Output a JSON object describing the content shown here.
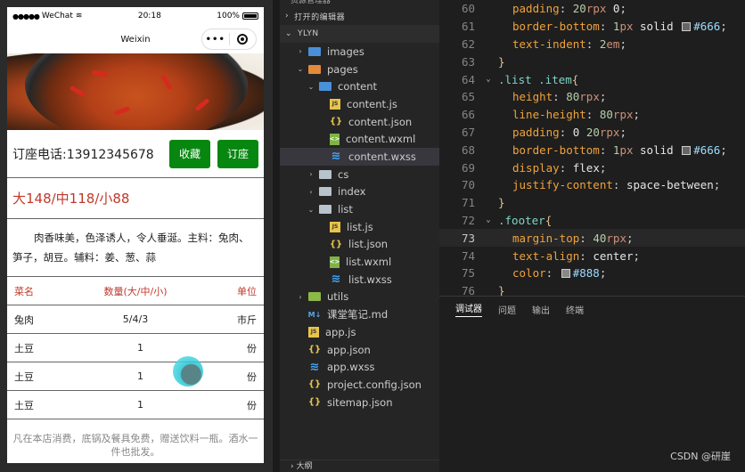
{
  "phone": {
    "status": {
      "carrier": "WeChat",
      "time": "20:18",
      "battery": "100%"
    },
    "nav_title": "Weixin",
    "capsule_more": "•••",
    "order_phone": "订座电话:13912345678",
    "buttons": {
      "favorite": "收藏",
      "reserve": "订座"
    },
    "price": "大148/中118/小88",
    "description": "肉香味美，色泽诱人，令人垂涎。主料：兔肉、笋子，胡豆。辅料：姜、葱、蒜",
    "table": {
      "headers": [
        "菜名",
        "数量(大/中/小)",
        "单位"
      ],
      "rows": [
        [
          "兔肉",
          "5/4/3",
          "市斤"
        ],
        [
          "土豆",
          "1",
          "份"
        ],
        [
          "土豆",
          "1",
          "份"
        ],
        [
          "土豆",
          "1",
          "份"
        ]
      ]
    },
    "footer": "凡在本店消费，底锅及餐具免费，赠送饮料一瓶。酒水一件也批发。"
  },
  "explorer": {
    "top_label": "资源管理器",
    "open_editors": "打开的编辑器",
    "project": "YLYN",
    "tree": [
      {
        "label": "images",
        "type": "folder",
        "color": "blue",
        "depth": 1,
        "chevron": "›"
      },
      {
        "label": "pages",
        "type": "folder",
        "color": "orange",
        "depth": 1,
        "chevron": "⌄"
      },
      {
        "label": "content",
        "type": "folder",
        "color": "blue",
        "depth": 2,
        "chevron": "⌄"
      },
      {
        "label": "content.js",
        "type": "js",
        "depth": 3
      },
      {
        "label": "content.json",
        "type": "json",
        "depth": 3
      },
      {
        "label": "content.wxml",
        "type": "wxml",
        "depth": 3
      },
      {
        "label": "content.wxss",
        "type": "wxss",
        "depth": 3,
        "selected": true
      },
      {
        "label": "cs",
        "type": "folder",
        "color": "gray",
        "depth": 2,
        "chevron": "›"
      },
      {
        "label": "index",
        "type": "folder",
        "color": "gray",
        "depth": 2,
        "chevron": "›"
      },
      {
        "label": "list",
        "type": "folder",
        "color": "gray",
        "depth": 2,
        "chevron": "⌄"
      },
      {
        "label": "list.js",
        "type": "js",
        "depth": 3
      },
      {
        "label": "list.json",
        "type": "json",
        "depth": 3
      },
      {
        "label": "list.wxml",
        "type": "wxml",
        "depth": 3
      },
      {
        "label": "list.wxss",
        "type": "wxss",
        "depth": 3
      },
      {
        "label": "utils",
        "type": "folder",
        "color": "green",
        "depth": 1,
        "chevron": "›"
      },
      {
        "label": "课堂笔记.md",
        "type": "md",
        "depth": 1
      },
      {
        "label": "app.js",
        "type": "js",
        "depth": 1
      },
      {
        "label": "app.json",
        "type": "json",
        "depth": 1
      },
      {
        "label": "app.wxss",
        "type": "wxss",
        "depth": 1
      },
      {
        "label": "project.config.json",
        "type": "json",
        "depth": 1
      },
      {
        "label": "sitemap.json",
        "type": "json",
        "depth": 1
      }
    ],
    "outline": "大纲"
  },
  "editor": {
    "current_line": 73,
    "lines": [
      {
        "n": 60,
        "indent": 1,
        "parts": [
          [
            "prop",
            "padding"
          ],
          [
            "punc",
            ": "
          ],
          [
            "num",
            "20"
          ],
          [
            "unit",
            "rpx"
          ],
          [
            "val",
            " 0"
          ],
          [
            "punc",
            ";"
          ]
        ]
      },
      {
        "n": 61,
        "indent": 1,
        "parts": [
          [
            "prop",
            "border-bottom"
          ],
          [
            "punc",
            ": "
          ],
          [
            "num",
            "1"
          ],
          [
            "unit",
            "px"
          ],
          [
            "val",
            " solid "
          ],
          [
            "swatch",
            "#666666"
          ],
          [
            "hex",
            "#666"
          ],
          [
            "punc",
            ";"
          ]
        ]
      },
      {
        "n": 62,
        "indent": 1,
        "parts": [
          [
            "prop",
            "text-indent"
          ],
          [
            "punc",
            ": "
          ],
          [
            "num",
            "2"
          ],
          [
            "unit",
            "em"
          ],
          [
            "punc",
            ";"
          ]
        ]
      },
      {
        "n": 63,
        "indent": 0,
        "parts": [
          [
            "brace",
            "}"
          ]
        ]
      },
      {
        "n": 64,
        "indent": 0,
        "fold": "⌄",
        "parts": [
          [
            "sel",
            ".list .item"
          ],
          [
            "brace",
            "{"
          ]
        ]
      },
      {
        "n": 65,
        "indent": 1,
        "parts": [
          [
            "prop",
            "height"
          ],
          [
            "punc",
            ": "
          ],
          [
            "num",
            "80"
          ],
          [
            "unit",
            "rpx"
          ],
          [
            "punc",
            ";"
          ]
        ]
      },
      {
        "n": 66,
        "indent": 1,
        "parts": [
          [
            "prop",
            "line-height"
          ],
          [
            "punc",
            ": "
          ],
          [
            "num",
            "80"
          ],
          [
            "unit",
            "rpx"
          ],
          [
            "punc",
            ";"
          ]
        ]
      },
      {
        "n": 67,
        "indent": 1,
        "parts": [
          [
            "prop",
            "padding"
          ],
          [
            "punc",
            ": "
          ],
          [
            "val",
            "0 "
          ],
          [
            "num",
            "20"
          ],
          [
            "unit",
            "rpx"
          ],
          [
            "punc",
            ";"
          ]
        ]
      },
      {
        "n": 68,
        "indent": 1,
        "parts": [
          [
            "prop",
            "border-bottom"
          ],
          [
            "punc",
            ": "
          ],
          [
            "num",
            "1"
          ],
          [
            "unit",
            "px"
          ],
          [
            "val",
            " solid "
          ],
          [
            "swatch",
            "#666666"
          ],
          [
            "hex",
            "#666"
          ],
          [
            "punc",
            ";"
          ]
        ]
      },
      {
        "n": 69,
        "indent": 1,
        "parts": [
          [
            "prop",
            "display"
          ],
          [
            "punc",
            ": "
          ],
          [
            "val",
            "flex"
          ],
          [
            "punc",
            ";"
          ]
        ]
      },
      {
        "n": 70,
        "indent": 1,
        "parts": [
          [
            "prop",
            "justify-content"
          ],
          [
            "punc",
            ": "
          ],
          [
            "val",
            "space-between"
          ],
          [
            "punc",
            ";"
          ]
        ]
      },
      {
        "n": 71,
        "indent": 0,
        "parts": [
          [
            "brace",
            "}"
          ]
        ]
      },
      {
        "n": 72,
        "indent": 0,
        "fold": "⌄",
        "parts": [
          [
            "sel",
            ".footer"
          ],
          [
            "brace",
            "{"
          ]
        ]
      },
      {
        "n": 73,
        "indent": 1,
        "parts": [
          [
            "prop",
            "margin-top"
          ],
          [
            "punc",
            ": "
          ],
          [
            "num",
            "40"
          ],
          [
            "unit",
            "rpx"
          ],
          [
            "punc",
            ";"
          ]
        ]
      },
      {
        "n": 74,
        "indent": 1,
        "parts": [
          [
            "prop",
            "text-align"
          ],
          [
            "punc",
            ": "
          ],
          [
            "val",
            "center"
          ],
          [
            "punc",
            ";"
          ]
        ]
      },
      {
        "n": 75,
        "indent": 1,
        "parts": [
          [
            "prop",
            "color"
          ],
          [
            "punc",
            ": "
          ],
          [
            "swatch",
            "#888888"
          ],
          [
            "hex",
            "#888"
          ],
          [
            "punc",
            ";"
          ]
        ]
      },
      {
        "n": 76,
        "indent": 0,
        "parts": [
          [
            "brace",
            "}"
          ]
        ]
      }
    ]
  },
  "panel": {
    "tabs": [
      "调试器",
      "问题",
      "输出",
      "终端"
    ],
    "active_tab": 0,
    "watermark": "CSDN @研崖"
  }
}
